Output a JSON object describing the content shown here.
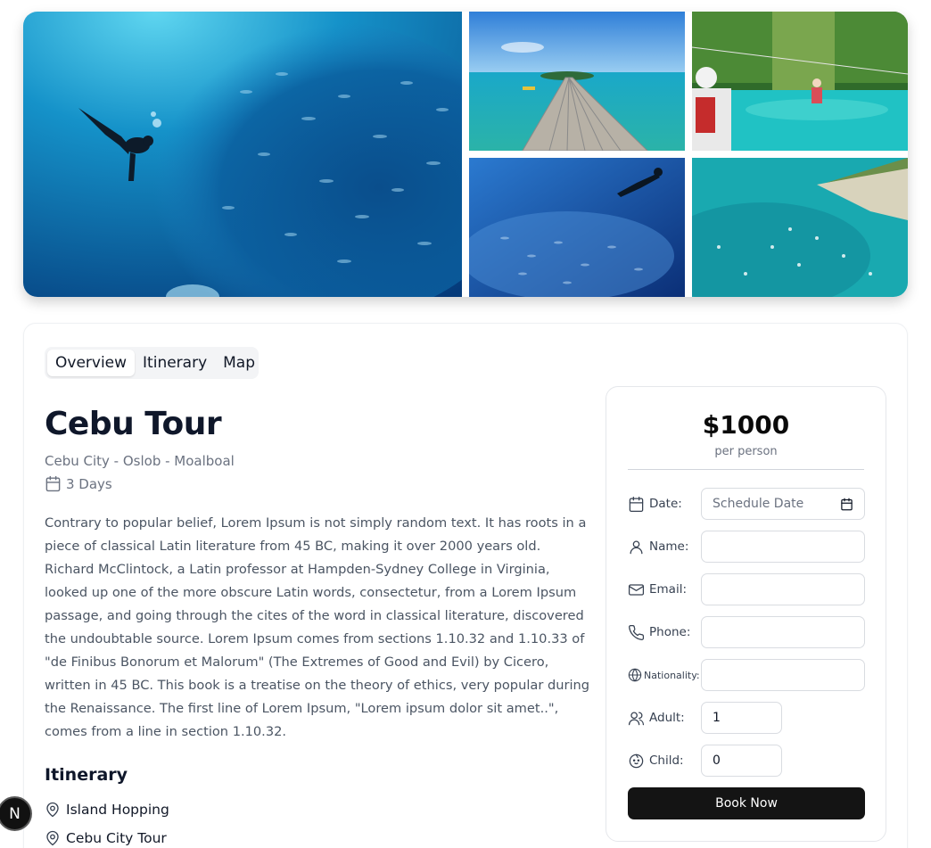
{
  "tour": {
    "title": "Cebu Tour",
    "route": "Cebu City - Oslob - Moalboal",
    "duration": "3 Days",
    "description": "Contrary to popular belief, Lorem Ipsum is not simply random text. It has roots in a piece of classical Latin literature from 45 BC, making it over 2000 years old. Richard McClintock, a Latin professor at Hampden-Sydney College in Virginia, looked up one of the more obscure Latin words, consectetur, from a Lorem Ipsum passage, and going through the cites of the word in classical literature, discovered the undoubtable source. Lorem Ipsum comes from sections 1.10.32 and 1.10.33 of \"de Finibus Bonorum et Malorum\" (The Extremes of Good and Evil) by Cicero, written in 45 BC. This book is a treatise on the theory of ethics, very popular during the Renaissance. The first line of Lorem Ipsum, \"Lorem ipsum dolor sit amet..\", comes from a line in section 1.10.32."
  },
  "tabs": [
    {
      "label": "Overview",
      "active": true
    },
    {
      "label": "Itinerary",
      "active": false
    },
    {
      "label": "Map",
      "active": false
    }
  ],
  "itinerary": {
    "heading": "Itinerary",
    "items": [
      "Island Hopping",
      "Cebu City Tour"
    ]
  },
  "booking": {
    "price": "$1000",
    "per": "per person",
    "date_label": "Date:",
    "date_placeholder": "Schedule Date",
    "name_label": "Name:",
    "email_label": "Email:",
    "phone_label": "Phone:",
    "nationality_label": "Nationality:",
    "adult_label": "Adult:",
    "adult_value": "1",
    "child_label": "Child:",
    "child_value": "0",
    "button": "Book Now"
  },
  "dev_badge": "N",
  "icons": {
    "duration": "calendar-icon",
    "itinerary_item": "map-pin-icon",
    "date": "calendar-icon",
    "name": "user-icon",
    "email": "mail-icon",
    "phone": "phone-icon",
    "nationality": "globe-icon",
    "adult": "users-icon",
    "child": "baby-icon"
  },
  "colors": {
    "button_bg": "#141414",
    "muted_text": "#6b7280",
    "tabs_bg": "#f3f4f6"
  }
}
